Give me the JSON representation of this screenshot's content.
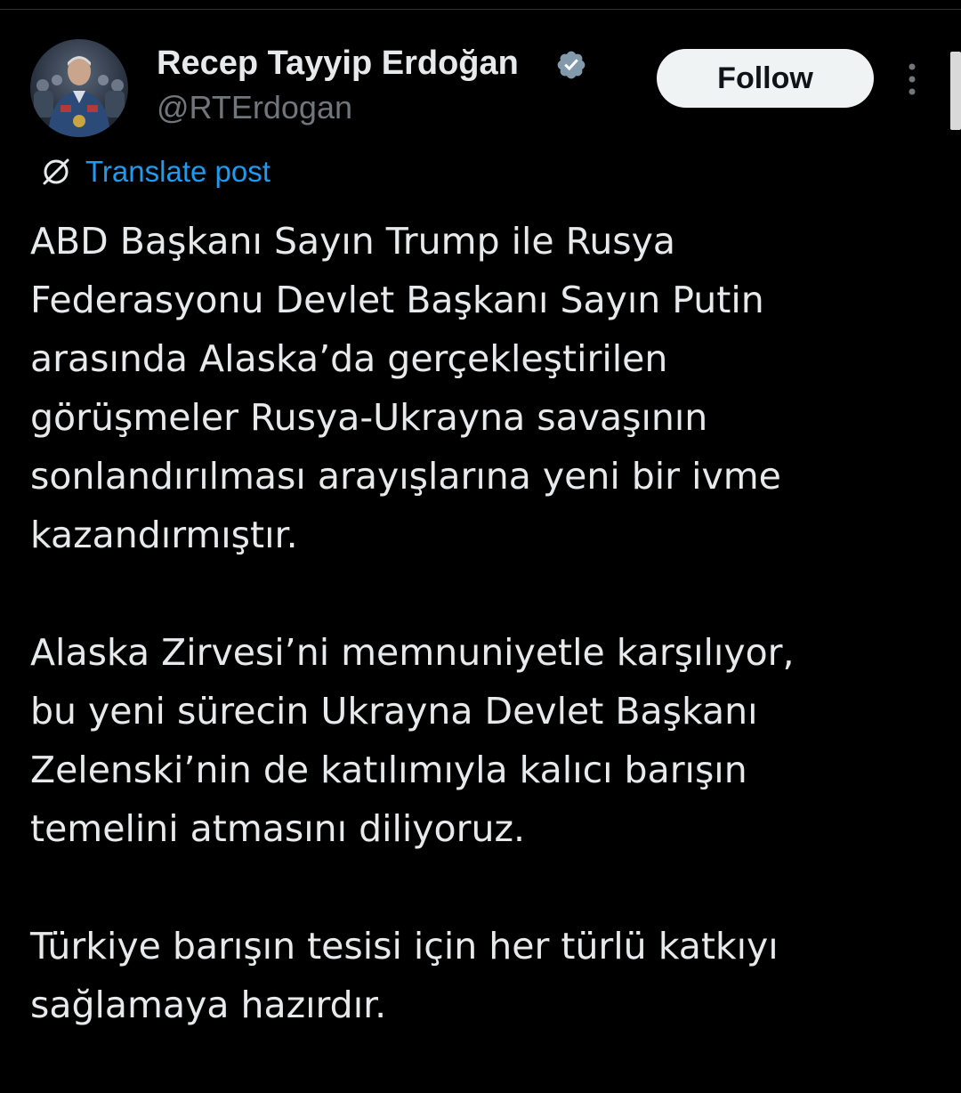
{
  "author": {
    "display_name": "Recep Tayyip Erdoğan",
    "handle": "@RTErdogan",
    "verified": true,
    "avatar_icon": "profile-photo"
  },
  "header": {
    "follow_label": "Follow",
    "more_icon": "more-vertical-icon"
  },
  "translate": {
    "label": "Translate post",
    "icon": "globe-icon"
  },
  "post": {
    "paragraphs": [
      {
        "lines": [
          "ABD Başkanı Sayın Trump ile Rusya",
          "Federasyonu Devlet Başkanı Sayın Putin",
          "arasında Alaska’da gerçekleştirilen",
          "görüşmeler Rusya-Ukrayna savaşının",
          "sonlandırılması arayışlarına yeni bir ivme",
          "kazandırmıştır."
        ]
      },
      {
        "lines": [
          "Alaska Zirvesi’ni memnuniyetle karşılıyor,",
          "bu yeni sürecin Ukrayna Devlet Başkanı",
          "Zelenski’nin de katılımıyla kalıcı barışın",
          "temelini atmasını diliyoruz."
        ]
      },
      {
        "lines": [
          "Türkiye barışın tesisi için her türlü katkıyı",
          "sağlamaya hazırdır."
        ]
      }
    ]
  },
  "colors": {
    "background": "#000000",
    "text_primary": "#e7e9ea",
    "text_secondary": "#71767b",
    "link": "#1d9bf0",
    "verified_badge": "#829aab",
    "follow_bg": "#eff3f4"
  }
}
